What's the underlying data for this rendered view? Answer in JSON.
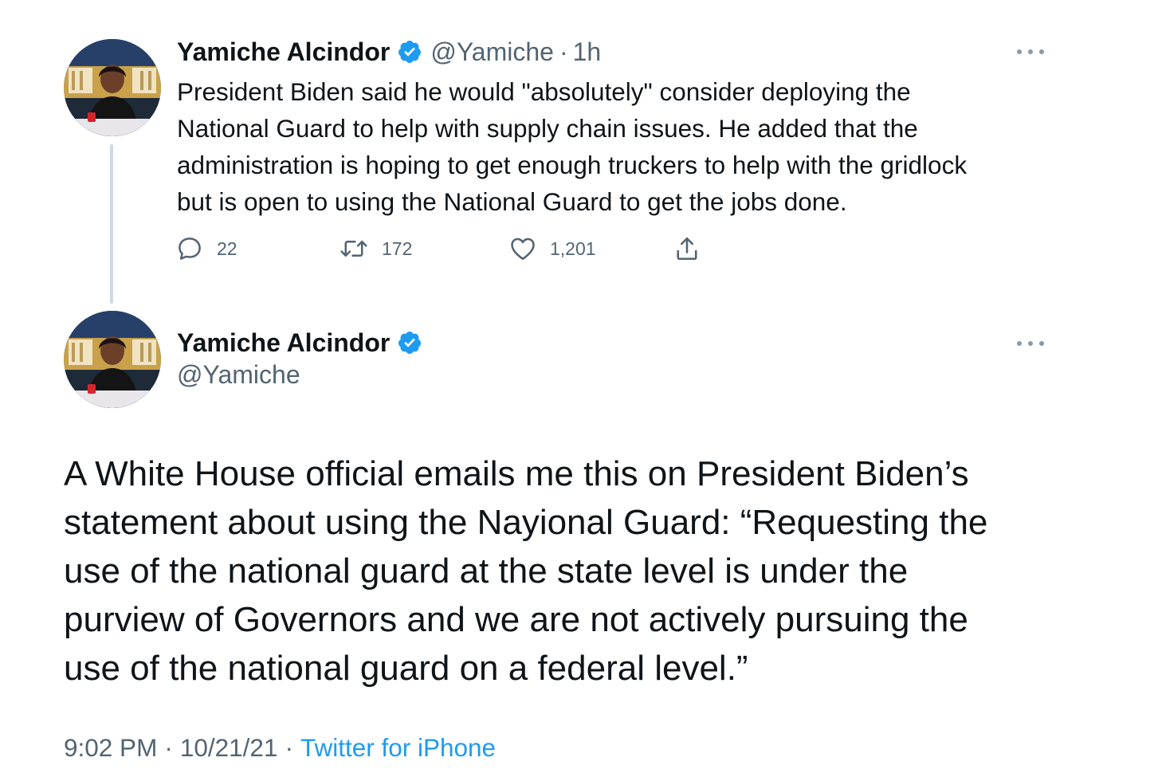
{
  "reply_context_tweet": {
    "author_name": "Yamiche Alcindor",
    "author_handle": "@Yamiche",
    "separator": "·",
    "time_ago": "1h",
    "text_lines": [
      "President Biden said he would \"absolutely\" consider deploying the",
      "National Guard to help with supply chain issues. He added that the",
      "administration is hoping to get enough truckers to help with the gridlock",
      "but is open to using the National Guard to get the jobs done."
    ],
    "replies": "22",
    "retweets": "172",
    "likes": "1,201"
  },
  "main_tweet": {
    "author_name": "Yamiche Alcindor",
    "author_handle": "@Yamiche",
    "text_lines": [
      "A White House official emails me this on President Biden’s",
      "statement about using the Nayional Guard: “Requesting the",
      "use of the national guard at the state level is under the",
      "purview of Governors and we are not actively pursuing the",
      "use of the national guard on a federal level.”"
    ],
    "time": "9:02 PM",
    "separator": "·",
    "date": "10/21/21",
    "source": "Twitter for iPhone"
  },
  "icons": {
    "verified": "verified-badge-icon",
    "more": "more-dots-icon",
    "reply": "reply-icon",
    "retweet": "retweet-icon",
    "like": "heart-icon",
    "share": "share-icon"
  },
  "colors": {
    "text_primary": "#0f1419",
    "text_secondary": "#536471",
    "verified_blue": "#1d9bf0",
    "link_blue": "#1d9bf0",
    "thread_line": "#cfd9de"
  }
}
